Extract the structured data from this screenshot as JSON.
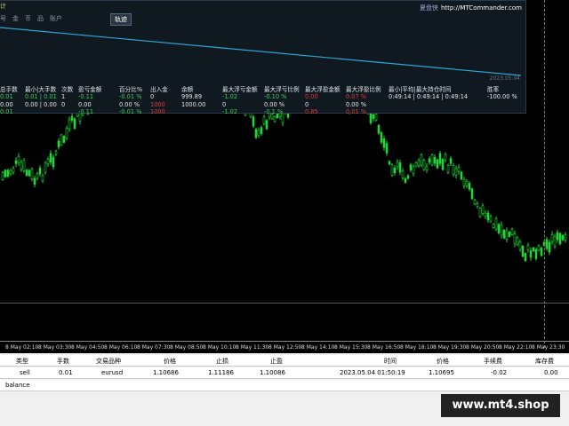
{
  "panel": {
    "title": "计",
    "menu": [
      "号",
      "金",
      "币",
      "品",
      "账户"
    ],
    "track_button": "轨迹",
    "brand_name": "夏盘侠",
    "brand_url": "http://MTCommander.com",
    "equity_date": "2023.05.04"
  },
  "stats": {
    "headers": [
      "总手数",
      "最小|大手数",
      "次数",
      "盈亏金额",
      "百分比%",
      "出入金",
      "余额",
      "最大浮亏金额",
      "最大浮亏比例",
      "最大浮盈金额",
      "最大浮盈比例",
      "最小|平均|最大持仓时间",
      "胜率"
    ],
    "row1": [
      "0.01",
      "0.01 | 0.01",
      "1",
      "-0.11",
      "-0.01 %",
      "0",
      "999.89",
      "-1.02",
      "-0.10 %",
      "0.00",
      "0.07 %",
      "0:49:14 | 0:49:14 | 0:49:14",
      "-100.00 %"
    ],
    "row2": [
      "0.00",
      "0.00 | 0.00",
      "0",
      "0.00",
      "0.00 %",
      "1000",
      "1000.00",
      "0",
      "0.00 %",
      "0",
      "0.00 %"
    ],
    "row3": [
      "0.01",
      "",
      "",
      "-0.11",
      "-0.01 %",
      "1000",
      "",
      "-1.02",
      "-0.1 %",
      "0.85",
      "0.01 %"
    ]
  },
  "time_axis": [
    "8 May 02:10",
    "8 May 03:30",
    "8 May 04:50",
    "8 May 06:10",
    "8 May 07:30",
    "8 May 08:50",
    "8 May 10:10",
    "8 May 11:30",
    "8 May 12:50",
    "8 May 14:10",
    "8 May 15:30",
    "8 May 16:50",
    "8 May 18:10",
    "8 May 19:30",
    "8 May 20:50",
    "8 May 22:10",
    "8 May 23:30"
  ],
  "terminal": {
    "headers": [
      "类型",
      "手数",
      "交易品种",
      "价格",
      "止损",
      "止盈",
      "时间",
      "价格",
      "手续费",
      "库存费"
    ],
    "row": [
      "sell",
      "0.01",
      "eurusd",
      "1.10686",
      "1.11186",
      "1.10086",
      "2023.05.04 01:50:19",
      "1.10695",
      "-0.02",
      "0.00"
    ],
    "balance_label": "balance"
  },
  "watermark": "www.mt4.shop",
  "colors": {
    "candle": "#22d63a",
    "equity_line": "#2aa8d8",
    "background": "#000000"
  }
}
